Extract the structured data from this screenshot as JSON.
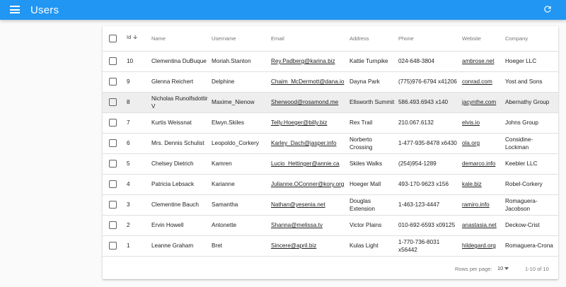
{
  "app": {
    "title": "Users"
  },
  "table": {
    "headers": {
      "id": "Id",
      "name": "Name",
      "username": "Username",
      "email": "Email",
      "address": "Address",
      "phone": "Phone",
      "website": "Website",
      "company": "Company"
    },
    "rows": [
      {
        "id": "10",
        "name": "Clementina DuBuque",
        "username": "Moriah.Stanton",
        "email": "Rey.Padberg@karina.biz",
        "address": "Kattie Turnpike",
        "phone": "024-648-3804",
        "website": "ambrose.net",
        "company": "Hoeger LLC"
      },
      {
        "id": "9",
        "name": "Glenna Reichert",
        "username": "Delphine",
        "email": "Chaim_McDermott@dana.io",
        "address": "Dayna Park",
        "phone": "(775)976-6794 x41206",
        "website": "conrad.com",
        "company": "Yost and Sons"
      },
      {
        "id": "8",
        "name": "Nicholas Runolfsdottir V",
        "username": "Maxime_Nienow",
        "email": "Sherwood@rosamond.me",
        "address": "Ellsworth Summit",
        "phone": "586.493.6943 x140",
        "website": "jacynthe.com",
        "company": "Abernathy Group"
      },
      {
        "id": "7",
        "name": "Kurtis Weissnat",
        "username": "Elwyn.Skiles",
        "email": "Telly.Hoeger@billy.biz",
        "address": "Rex Trail",
        "phone": "210.067.6132",
        "website": "elvis.io",
        "company": "Johns Group"
      },
      {
        "id": "6",
        "name": "Mrs. Dennis Schulist",
        "username": "Leopoldo_Corkery",
        "email": "Karley_Dach@jasper.info",
        "address": "Norberto Crossing",
        "phone": "1-477-935-8478 x6430",
        "website": "ola.org",
        "company": "Considine-Lockman"
      },
      {
        "id": "5",
        "name": "Chelsey Dietrich",
        "username": "Kamren",
        "email": "Lucio_Hettinger@annie.ca",
        "address": "Skiles Walks",
        "phone": "(254)954-1289",
        "website": "demarco.info",
        "company": "Keebler LLC"
      },
      {
        "id": "4",
        "name": "Patricia Lebsack",
        "username": "Karianne",
        "email": "Julianne.OConner@kory.org",
        "address": "Hoeger Mall",
        "phone": "493-170-9623 x156",
        "website": "kale.biz",
        "company": "Robel-Corkery"
      },
      {
        "id": "3",
        "name": "Clementine Bauch",
        "username": "Samantha",
        "email": "Nathan@yesenia.net",
        "address": "Douglas Extension",
        "phone": "1-463-123-4447",
        "website": "ramiro.info",
        "company": "Romaguera-Jacobson"
      },
      {
        "id": "2",
        "name": "Ervin Howell",
        "username": "Antonette",
        "email": "Shanna@melissa.tv",
        "address": "Victor Plains",
        "phone": "010-692-6593 x09125",
        "website": "anastasia.net",
        "company": "Deckow-Crist"
      },
      {
        "id": "1",
        "name": "Leanne Graham",
        "username": "Bret",
        "email": "Sincere@april.biz",
        "address": "Kulas Light",
        "phone": "1-770-736-8031 x56442",
        "website": "hildegard.org",
        "company": "Romaguera-Crona"
      }
    ]
  },
  "footer": {
    "rows_per_page_label": "Rows per page:",
    "rows_per_page_value": "10",
    "range_text": "1-10 of 10"
  },
  "icons": {
    "menu": "menu-icon",
    "refresh": "refresh-icon",
    "sort": "arrow-down-icon"
  },
  "colors": {
    "appbar": "#2196f3",
    "row_highlight": "#eeeeee"
  }
}
